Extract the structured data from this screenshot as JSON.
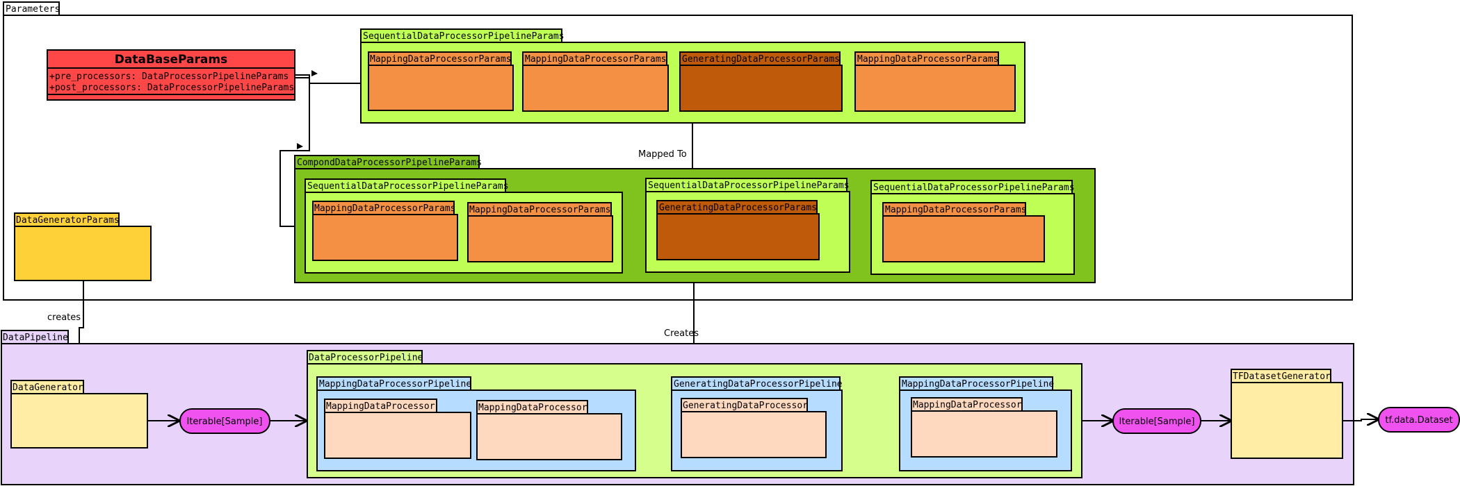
{
  "colors": {
    "params_red": "#ff4747",
    "light_green": "#bfff55",
    "dark_green": "#80c31e",
    "orange": "#f49043",
    "dark_orange": "#c05a0b",
    "yellow": "#ffd138",
    "pale_yellow": "#ffeda6",
    "lavender": "#e8d3fb",
    "pale_green": "#d6fe8c",
    "light_blue": "#b6dcff",
    "peach": "#ffd9bf",
    "magenta": "#f052f0"
  },
  "parameters": {
    "label": "Parameters",
    "database_params": {
      "title": "DataBaseParams",
      "attr1": "+pre_processors: DataProcessorPipelineParams",
      "attr2": "+post_processors: DataProcessorPipelineParams"
    },
    "sequential_top": {
      "label": "SequentialDataProcessorPipelineParams",
      "item1": "MappingDataProcessorParams",
      "item2": "MappingDataProcessorParams",
      "item3": "GeneratingDataProcessorParams",
      "item4": "MappingDataProcessorParams"
    },
    "mapped_to": "Mapped To",
    "compound": {
      "label": "CompondDataProcessorPipelineParams",
      "seq1_label": "SequentialDataProcessorPipelineParams",
      "seq1_item1": "MappingDataProcessorParams",
      "seq1_item2": "MappingDataProcessorParams",
      "seq2_label": "SequentialDataProcessorPipelineParams",
      "seq2_item1": "GeneratingDataProcessorParams",
      "seq3_label": "SequentialDataProcessorPipelineParams",
      "seq3_item1": "MappingDataProcessorParams"
    },
    "generator_params": "DataGeneratorParams",
    "creates": "creates"
  },
  "creates_upper": "Creates",
  "pipeline": {
    "label": "DataPipeline",
    "data_generator": "DataGenerator",
    "iterable1": "Iterable[Sample]",
    "processor_pipeline": {
      "label": "DataProcessorPipeline",
      "mapping1_label": "MappingDataProcessorPipeline",
      "mapping1_item1": "MappingDataProcessor",
      "mapping1_item2": "MappingDataProcessor",
      "generating_label": "GeneratingDataProcessorPipeline",
      "generating_item1": "GeneratingDataProcessor",
      "mapping2_label": "MappingDataProcessorPipeline",
      "mapping2_item1": "MappingDataProcessor"
    },
    "iterable2": "Iterable[Sample]",
    "tf_generator": "TFDatasetGenerator",
    "tf_dataset": "tf.data.Dataset"
  }
}
